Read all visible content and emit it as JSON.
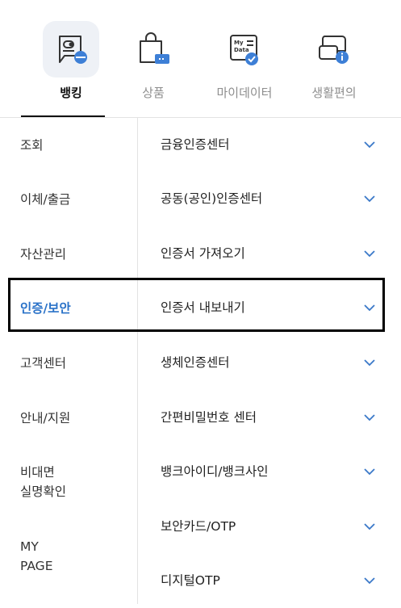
{
  "tabs": [
    {
      "label": "뱅킹",
      "icon": "bank-card-icon",
      "active": true
    },
    {
      "label": "상품",
      "icon": "shopping-bag-icon",
      "active": false
    },
    {
      "label": "마이데이터",
      "icon": "my-data-icon",
      "active": false
    },
    {
      "label": "생활편의",
      "icon": "chat-info-icon",
      "active": false
    }
  ],
  "mydata_icon_text": {
    "line1": "My",
    "line2": "Data"
  },
  "left_nav": [
    {
      "label": "조회"
    },
    {
      "label": "이체/출금"
    },
    {
      "label": "자산관리"
    },
    {
      "label": "인증/보안",
      "selected": true
    },
    {
      "label": "고객센터"
    },
    {
      "label": "안내/지원"
    },
    {
      "label": "비대면\n실명확인"
    },
    {
      "label": "MY\nPAGE"
    }
  ],
  "right_menu": [
    {
      "label": "금융인증센터"
    },
    {
      "label": "공동(공인)인증센터"
    },
    {
      "label": "인증서 가져오기"
    },
    {
      "label": "인증서 내보내기",
      "highlighted": true
    },
    {
      "label": "생체인증센터"
    },
    {
      "label": "간편비밀번호 센터"
    },
    {
      "label": "뱅크아이디/뱅크사인"
    },
    {
      "label": "보안카드/OTP"
    },
    {
      "label": "디지털OTP"
    }
  ],
  "colors": {
    "accent": "#2a72c8",
    "chevron": "#3a78c8"
  }
}
